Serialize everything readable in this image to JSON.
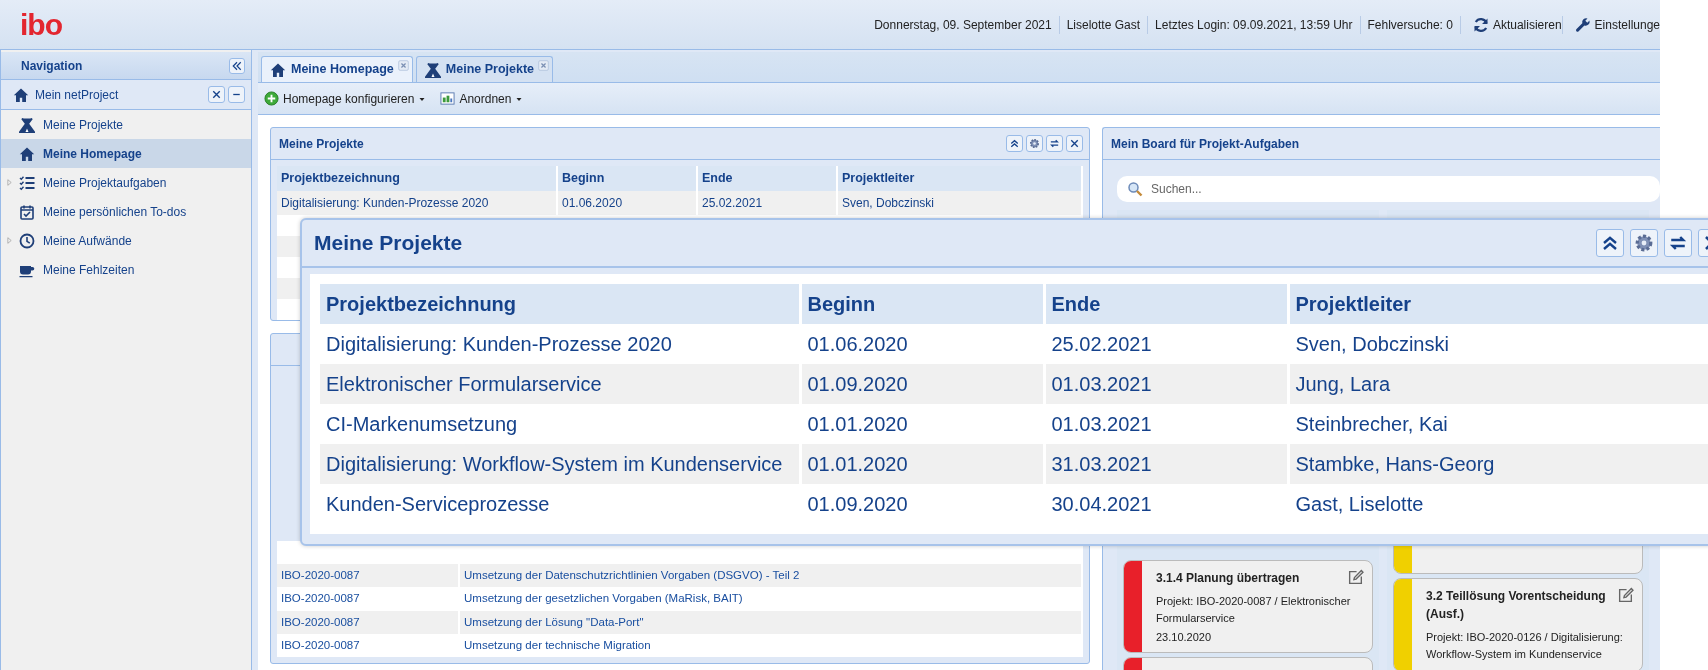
{
  "header": {
    "logo": "ibo",
    "date": "Donnerstag, 09. September 2021",
    "user": "Liselotte Gast",
    "last_login": "Letztes Login: 09.09.2021, 13:59 Uhr",
    "failed_attempts": "Fehlversuche: 0",
    "actions": [
      {
        "kind": "refresh",
        "label": "Aktualisieren"
      },
      {
        "kind": "settings",
        "label": "Einstellunge"
      }
    ]
  },
  "sidebar": {
    "title": "Navigation",
    "group": "Mein netProject",
    "items": [
      {
        "label": "Meine Projekte",
        "selected": false
      },
      {
        "label": "Meine Homepage",
        "selected": true
      },
      {
        "label": "Meine Projektaufgaben",
        "selected": false,
        "expanded": false
      },
      {
        "label": "Meine persönlichen To-dos",
        "selected": false
      },
      {
        "label": "Meine Aufwände",
        "selected": false,
        "expanded": false
      },
      {
        "label": "Meine Fehlzeiten",
        "selected": false
      }
    ]
  },
  "tabs": [
    {
      "label": "Meine Homepage",
      "selected": true
    },
    {
      "label": "Meine Projekte",
      "selected": false
    }
  ],
  "toolbar": [
    {
      "kind": "add",
      "label": "Homepage konfigurieren"
    },
    {
      "kind": "layout",
      "label": "Anordnen"
    }
  ],
  "projects_portlet": {
    "title": "Meine Projekte",
    "columns": [
      "Projektbezeichnung",
      "Beginn",
      "Ende",
      "Projektleiter"
    ],
    "rows": [
      [
        "Digitalisierung: Kunden-Prozesse 2020",
        "01.06.2020",
        "25.02.2021",
        "Sven, Dobczinski"
      ]
    ]
  },
  "tasks_portlet": {
    "rows": [
      [
        "IBO-2020-0087",
        "Umsetzung der Datenschutzrichtlinien Vorgaben (DSGVO) - Teil 2"
      ],
      [
        "IBO-2020-0087",
        "Umsetzung der gesetzlichen Vorgaben (MaRisk, BAIT)"
      ],
      [
        "IBO-2020-0087",
        "Umsetzung der Lösung \"Data-Port\""
      ],
      [
        "IBO-2020-0087",
        "Umsetzung der technische Migration"
      ]
    ]
  },
  "board": {
    "title": "Mein Board für Projekt-Aufgaben",
    "search": {
      "placeholder": "Suchen..."
    },
    "columns": [
      {
        "cards": [
          {
            "color": "#e8202a",
            "title": "3.1.4 Planung übertragen",
            "project": "Projekt: IBO-2020-0087 / Elektronischer Formularservice",
            "date": "23.10.2020"
          },
          {
            "color": "#e8202a"
          }
        ]
      },
      {
        "cards": [
          {
            "color": "#f0d000"
          },
          {
            "color": "#f0d000",
            "title": "3.2 Teillösung Vorentscheidung (Ausf.)",
            "project": "Projekt: IBO-2020-0126 / Digitalisierung: Workflow-System im Kundenservice"
          }
        ]
      }
    ]
  },
  "overlay": {
    "title": "Meine Projekte",
    "columns": [
      "Projektbezeichnung",
      "Beginn",
      "Ende",
      "Projektleiter"
    ],
    "rows": [
      [
        "Digitalisierung: Kunden-Prozesse 2020",
        "01.06.2020",
        "25.02.2021",
        "Sven, Dobczinski"
      ],
      [
        "Elektronischer Formularservice",
        "01.09.2020",
        "01.03.2021",
        "Jung, Lara"
      ],
      [
        "CI-Markenumsetzung",
        "01.01.2020",
        "01.03.2021",
        "Steinbrecher, Kai"
      ],
      [
        "Digitalisierung: Workflow-System im Kundenservice",
        "01.01.2020",
        "31.03.2021",
        "Stambke, Hans-Georg"
      ],
      [
        "Kunden-Serviceprozesse",
        "01.09.2020",
        "30.04.2021",
        "Gast, Liselotte"
      ]
    ]
  }
}
